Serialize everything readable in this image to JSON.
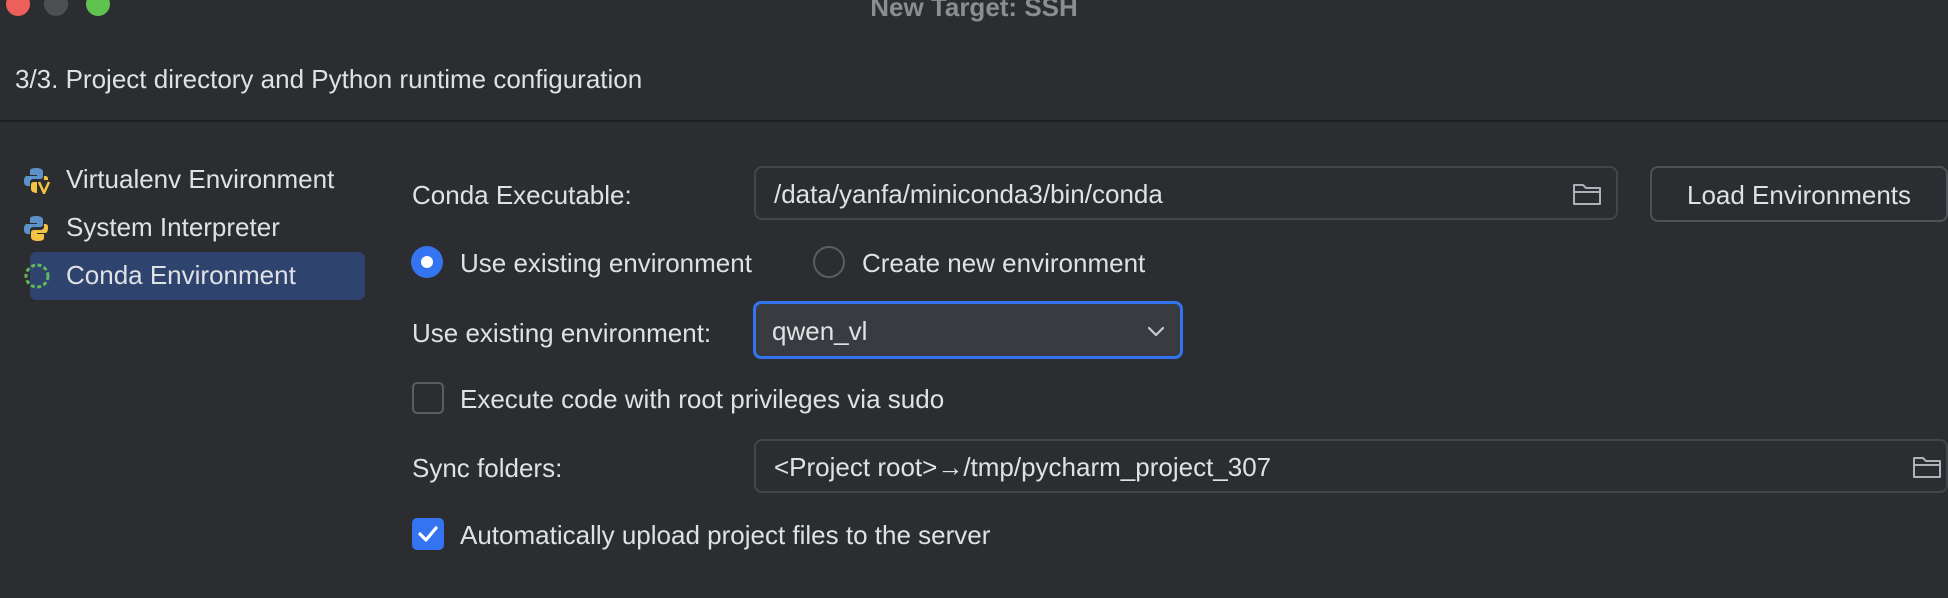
{
  "window": {
    "title": "New Target: SSH"
  },
  "step_title": "3/3. Project directory and Python runtime configuration",
  "sidebar": {
    "items": [
      {
        "label": "Virtualenv Environment",
        "icon": "virtualenv-python-icon",
        "selected": false
      },
      {
        "label": "System Interpreter",
        "icon": "python-icon",
        "selected": false
      },
      {
        "label": "Conda Environment",
        "icon": "conda-icon",
        "selected": true
      }
    ]
  },
  "form": {
    "conda_executable_label": "Conda Executable:",
    "conda_executable_value": "/data/yanfa/miniconda3/bin/conda",
    "load_environments_button": "Load Environments",
    "radio_use_existing": "Use existing environment",
    "radio_create_new": "Create new environment",
    "radio_selected": "use_existing",
    "existing_env_label": "Use existing environment:",
    "existing_env_value": "qwen_vl",
    "sudo_checkbox_label": "Execute code with root privileges via sudo",
    "sudo_checked": false,
    "sync_folders_label": "Sync folders:",
    "sync_folders_value": "<Project root>→/tmp/pycharm_project_307",
    "auto_upload_label": "Automatically upload project files to the server",
    "auto_upload_checked": true
  },
  "colors": {
    "background": "#2b2d30",
    "accent": "#3574f0",
    "selection": "#2e436e",
    "text": "#dfe1e5",
    "close": "#ec5f5a",
    "minimize": "#4e4f53",
    "maximize": "#5fc350"
  }
}
